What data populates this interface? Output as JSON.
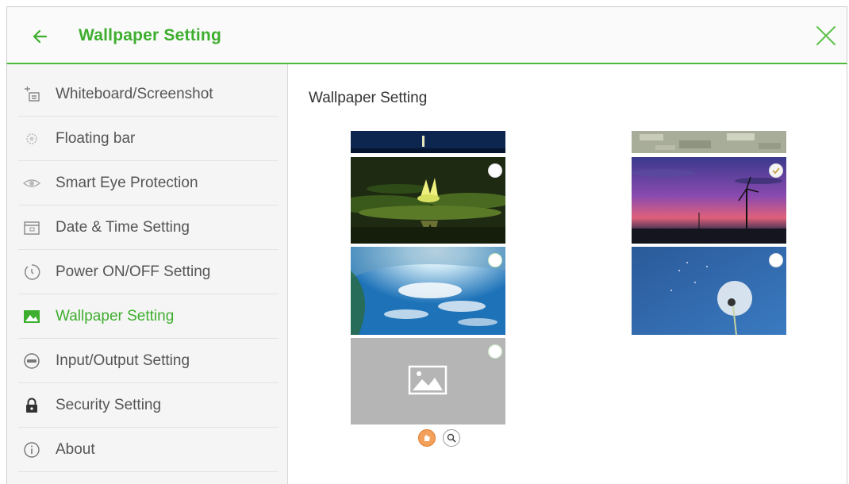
{
  "header": {
    "title": "Wallpaper Setting",
    "back_icon": "arrow-left-icon",
    "close_icon": "close-icon",
    "accent_color": "#3eae2e"
  },
  "sidebar": {
    "items": [
      {
        "label": "Whiteboard/Screenshot",
        "icon": "whiteboard-icon",
        "active": false
      },
      {
        "label": "Floating bar",
        "icon": "floating-bar-icon",
        "active": false
      },
      {
        "label": "Smart Eye Protection",
        "icon": "eye-icon",
        "active": false
      },
      {
        "label": "Date & Time Setting",
        "icon": "calendar-icon",
        "active": false
      },
      {
        "label": "Power ON/OFF Setting",
        "icon": "power-timer-icon",
        "active": false
      },
      {
        "label": "Wallpaper Setting",
        "icon": "image-icon",
        "active": true
      },
      {
        "label": "Input/Output Setting",
        "icon": "input-output-icon",
        "active": false
      },
      {
        "label": "Security Setting",
        "icon": "lock-icon",
        "active": false
      },
      {
        "label": "About",
        "icon": "info-icon",
        "active": false
      }
    ]
  },
  "main": {
    "title": "Wallpaper Setting",
    "wallpapers": [
      {
        "name": "water-lily",
        "selected": false
      },
      {
        "name": "sky-clouds",
        "selected": false
      },
      {
        "name": "custom-placeholder",
        "selected": false
      },
      {
        "name": "wind-turbine-sunset",
        "selected": true
      },
      {
        "name": "dandelion",
        "selected": false
      }
    ],
    "tools": [
      "select-image-icon",
      "zoom-icon"
    ]
  }
}
